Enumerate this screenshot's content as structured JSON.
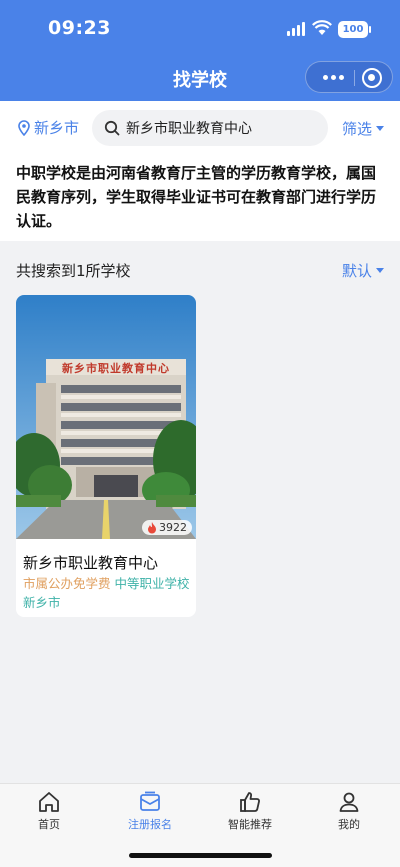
{
  "status": {
    "time": "09:23",
    "battery": "100"
  },
  "nav": {
    "title": "找学校"
  },
  "search": {
    "location": "新乡市",
    "query": "新乡市职业教育中心",
    "filter": "筛选"
  },
  "notice": {
    "text": "中职学校是由河南省教育厅主管的学历教育学校，属国民教育序列，学生取得毕业证书可在教育部门进行学历认证。"
  },
  "results": {
    "count_text": "共搜索到1所学校",
    "sort": "默认"
  },
  "schools": [
    {
      "name": "新乡市职业教育中心",
      "heat": "3922",
      "fee_tag": "市属公办免学费",
      "type_tag": "中等职业学校",
      "city_tag": "新乡市",
      "photo_banner": "新乡市职业教育中心"
    }
  ],
  "tabbar": {
    "items": [
      {
        "label": "首页",
        "icon": "home-icon"
      },
      {
        "label": "注册报名",
        "icon": "mail-icon"
      },
      {
        "label": "智能推荐",
        "icon": "thumbs-up-icon"
      },
      {
        "label": "我的",
        "icon": "user-icon"
      }
    ]
  },
  "colors": {
    "primary": "#4a82e8",
    "fee_tag": "#e0a060",
    "type_tag": "#3fb2a8"
  }
}
